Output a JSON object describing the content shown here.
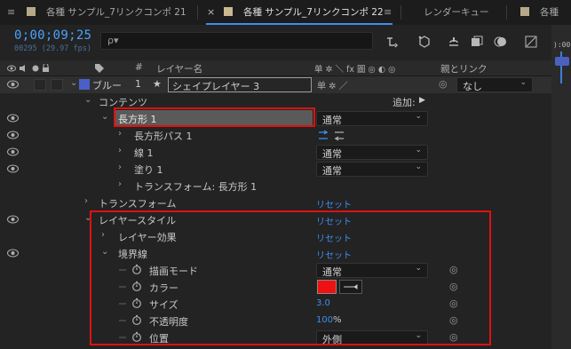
{
  "tabs": {
    "tab1": "各種 サンプル_7リンクコンポ 21",
    "tab2": "各種 サンプル_7リンクコンポ 22",
    "tab3": "レンダーキュー",
    "tab4": "各種",
    "close": "×",
    "menu": "≡"
  },
  "header": {
    "timecode": "0;00;09;25",
    "fps": "00295 (29.97 fps)",
    "search_placeholder": "",
    "search_glyph": "ρ▾"
  },
  "right_strip": {
    "time": "):00s"
  },
  "columns": {
    "layer_num": "#",
    "layer_name": "レイヤー名",
    "switches": "单 ✲ ＼ fx 圖 ◎ ◐ ◎",
    "parent": "親とリンク"
  },
  "layer": {
    "color_label": "ブルー",
    "number": "1",
    "star": "★",
    "name": "シェイプレイヤー 3",
    "switches": "单 ✲ ／",
    "parent_value": "なし",
    "parent_icon": "◎"
  },
  "rows": {
    "contents": "コンテンツ",
    "add": "追加:",
    "add_icon": "▶",
    "rect1": "長方形 1",
    "rect1_mode": "通常",
    "rect_path": "長方形パス 1",
    "stroke1": "線 1",
    "stroke1_mode": "通常",
    "fill1": "塗り 1",
    "fill1_mode": "通常",
    "transform_rect": "トランスフォーム: 長方形 1",
    "transform": "トランスフォーム",
    "transform_reset": "リセット",
    "layer_styles": "レイヤースタイル",
    "layer_styles_reset": "リセット",
    "layer_effects": "レイヤー効果",
    "layer_effects_reset": "リセット",
    "border": "境界線",
    "border_reset": "リセット",
    "blend_mode": "描画モード",
    "blend_mode_value": "通常",
    "color": "カラー",
    "color_value": "#ee1111",
    "size": "サイズ",
    "size_value": "3.0",
    "opacity": "不透明度",
    "opacity_value": "100",
    "opacity_unit": "%",
    "position": "位置",
    "position_value": "外側"
  },
  "colors": {
    "accent": "#3d8ef0",
    "highlight": "#e01010",
    "tab1_swatch": "#b6a98a",
    "tab2_swatch": "#c9b890",
    "label_blue": "#4a5fc8"
  }
}
